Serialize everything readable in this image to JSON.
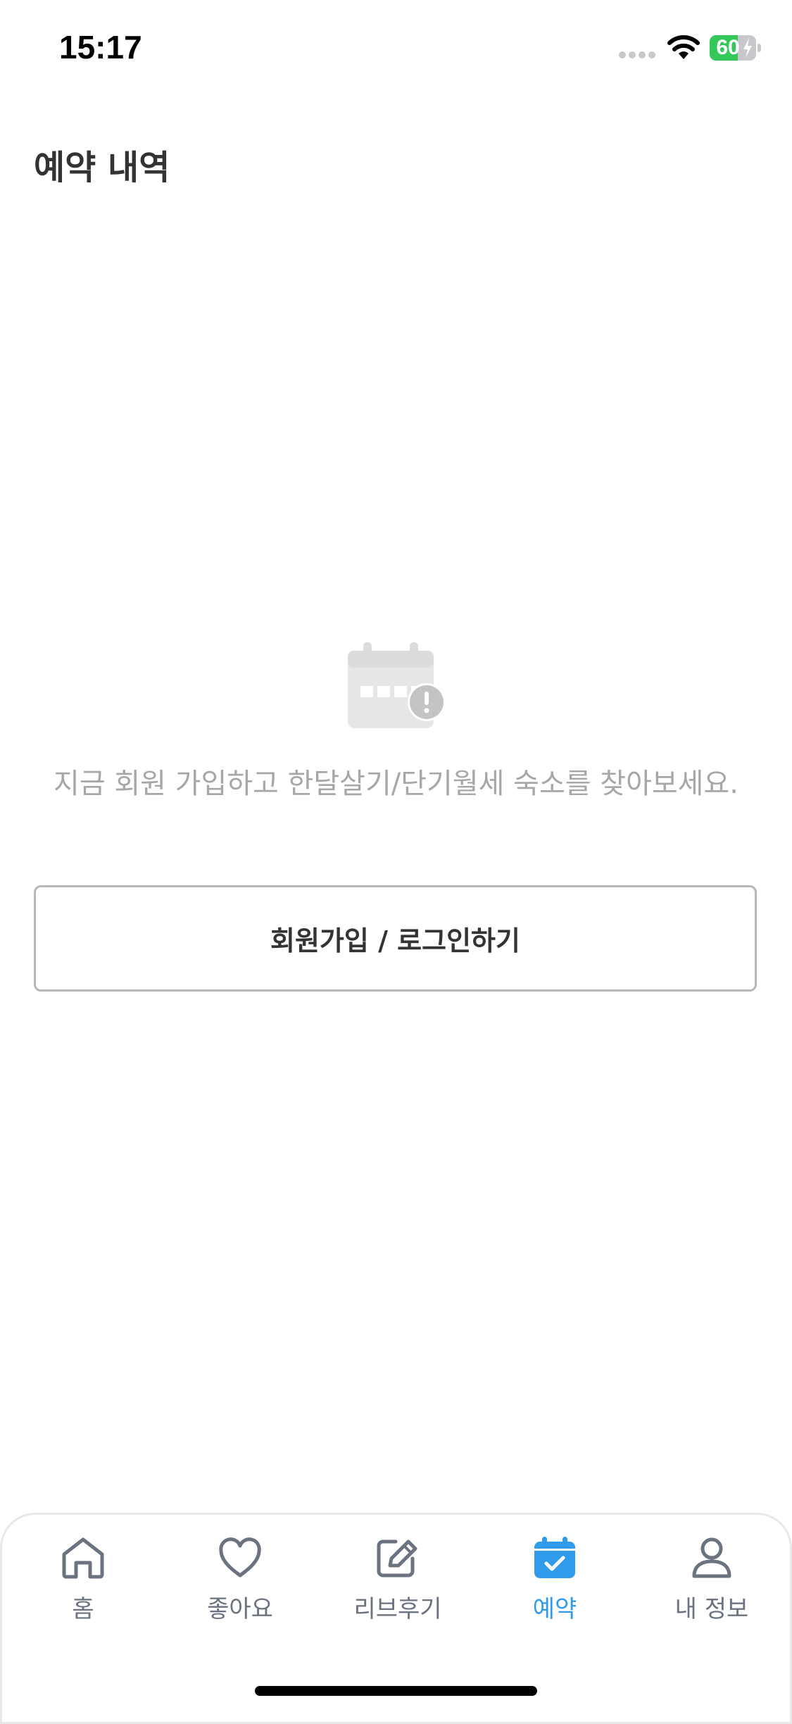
{
  "status_bar": {
    "time": "15:17",
    "battery": "60"
  },
  "header": {
    "title": "예약 내역"
  },
  "empty_state": {
    "icon": "calendar-alert-icon",
    "message": "지금 회원 가입하고 한달살기/단기월세 숙소를 찾아보세요."
  },
  "login_button": {
    "label": "회원가입 / 로그인하기"
  },
  "tab_bar": {
    "tabs": [
      {
        "label": "홈",
        "icon": "home-icon",
        "active": false
      },
      {
        "label": "좋아요",
        "icon": "heart-icon",
        "active": false
      },
      {
        "label": "리브후기",
        "icon": "edit-note-icon",
        "active": false
      },
      {
        "label": "예약",
        "icon": "calendar-check-icon",
        "active": true
      },
      {
        "label": "내 정보",
        "icon": "user-icon",
        "active": false
      }
    ]
  },
  "colors": {
    "accent": "#2f9bea",
    "inactive": "#6b7280",
    "muted_text": "#a7a7a7",
    "battery_green": "#34c759"
  }
}
